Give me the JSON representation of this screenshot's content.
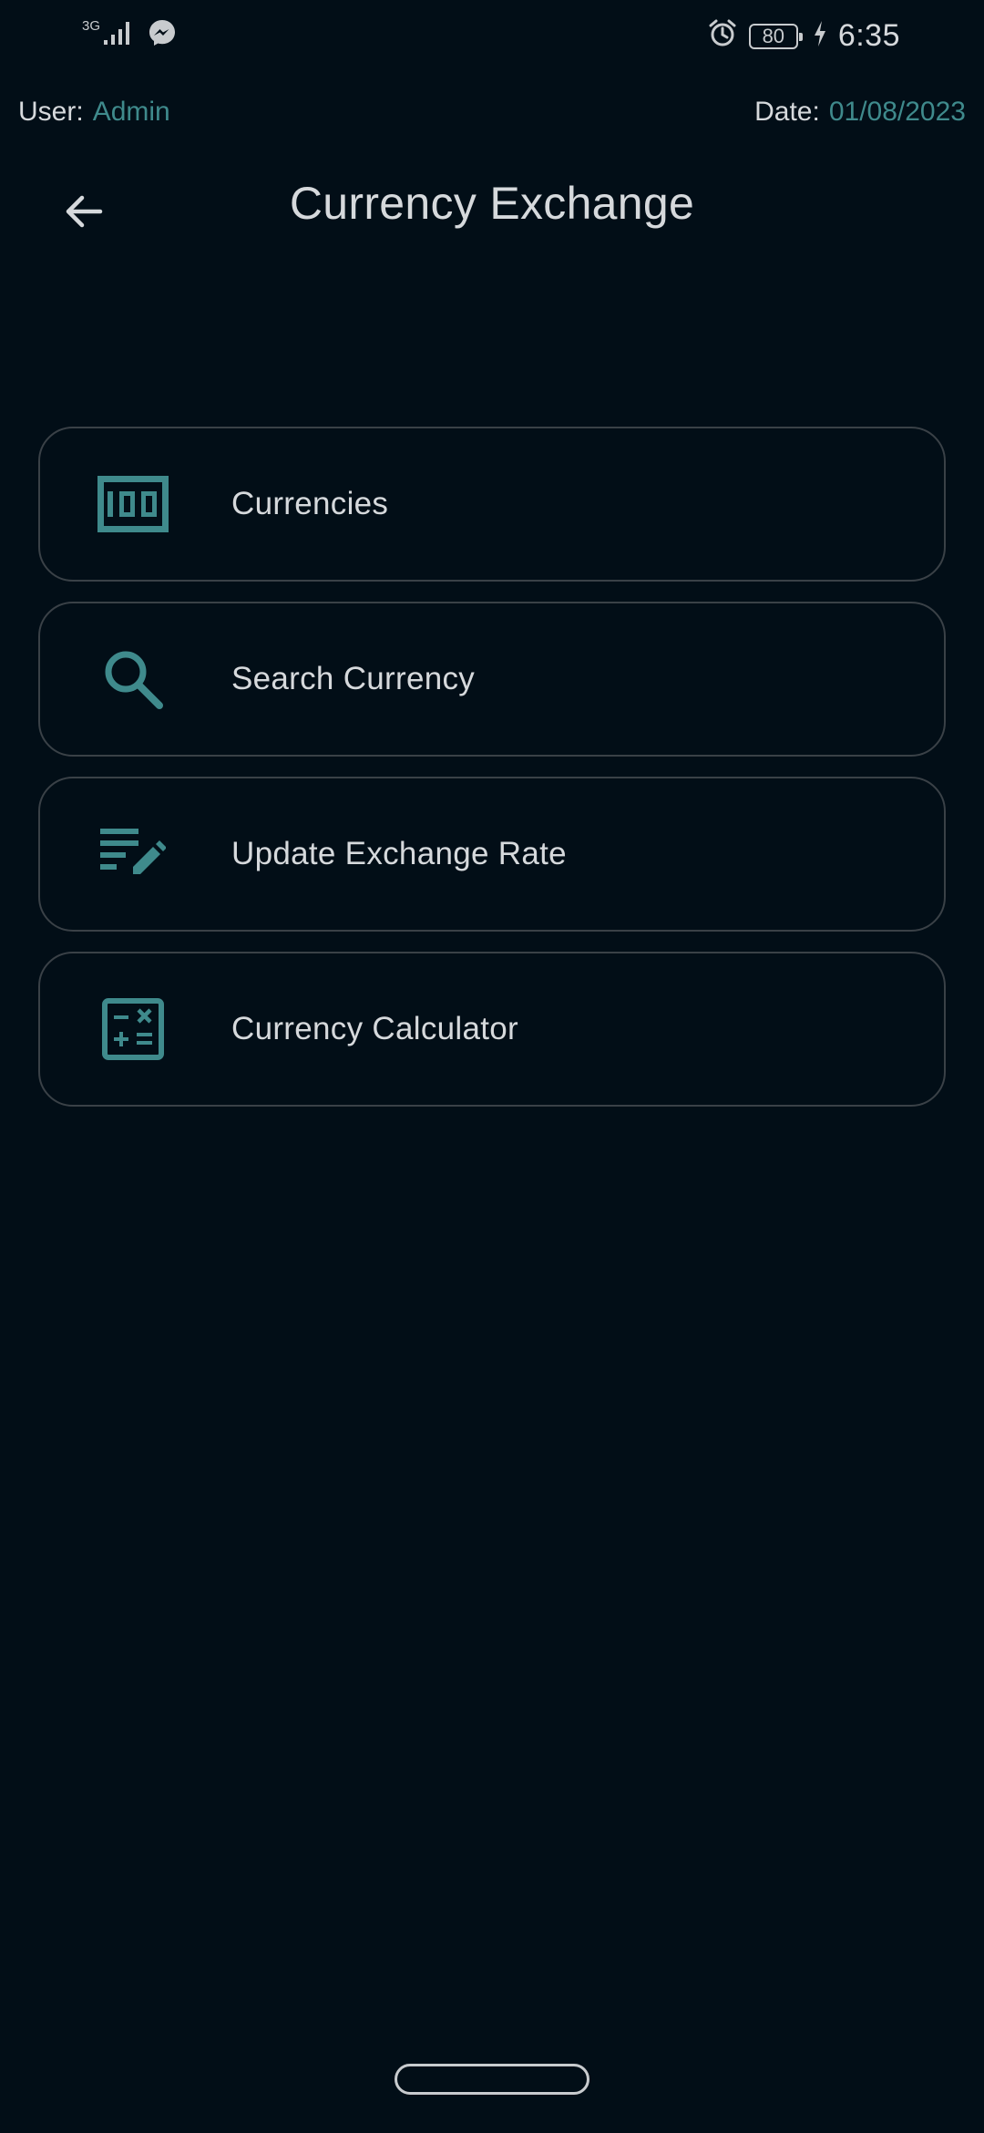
{
  "status_bar": {
    "network_type": "3G",
    "battery": "80",
    "time": "6:35",
    "icons": [
      "signal-icon",
      "messenger-icon",
      "alarm-icon",
      "battery-icon",
      "charging-icon"
    ]
  },
  "info": {
    "user_label": "User:",
    "user_value": "Admin",
    "date_label": "Date:",
    "date_value": "01/08/2023"
  },
  "header": {
    "back_icon": "arrow-left-icon",
    "title": "Currency Exchange"
  },
  "menu": {
    "items": [
      {
        "label": "Currencies",
        "icon": "money-bill-icon"
      },
      {
        "label": "Search Currency",
        "icon": "search-icon"
      },
      {
        "label": "Update Exchange Rate",
        "icon": "edit-list-icon"
      },
      {
        "label": "Currency Calculator",
        "icon": "calculator-icon"
      }
    ]
  },
  "colors": {
    "background": "#020e17",
    "accent": "#3f8a8c",
    "text": "#d6d9dc",
    "card_border": "#3a4147"
  }
}
